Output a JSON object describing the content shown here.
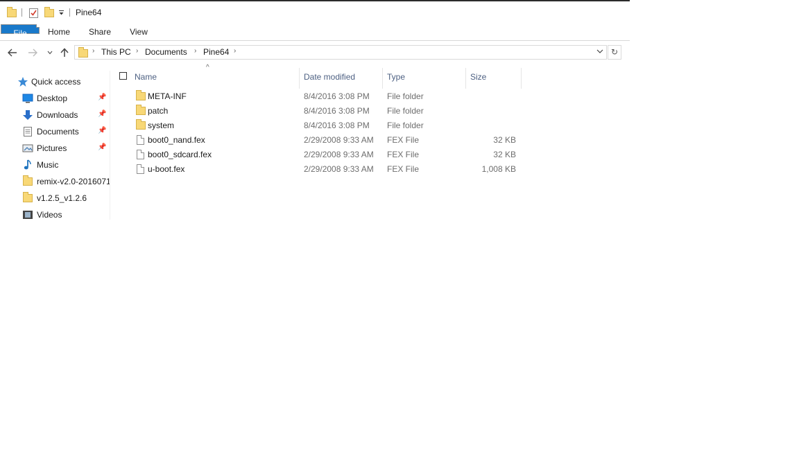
{
  "window": {
    "title": "Pine64"
  },
  "ribbon": {
    "tabs": [
      "File",
      "Home",
      "Share",
      "View"
    ]
  },
  "address": {
    "crumbs": [
      "This PC",
      "Documents",
      "Pine64"
    ]
  },
  "sidebar": {
    "items": [
      {
        "label": "Quick access",
        "icon": "star-icon",
        "pinned": false
      },
      {
        "label": "Desktop",
        "icon": "desktop-icon",
        "pinned": true
      },
      {
        "label": "Downloads",
        "icon": "download-icon",
        "pinned": true
      },
      {
        "label": "Documents",
        "icon": "documents-icon",
        "pinned": true
      },
      {
        "label": "Pictures",
        "icon": "pictures-icon",
        "pinned": true
      },
      {
        "label": "Music",
        "icon": "music-icon",
        "pinned": false
      },
      {
        "label": "remix-v2.0-2016071",
        "icon": "folder-icon",
        "pinned": false
      },
      {
        "label": "v1.2.5_v1.2.6",
        "icon": "folder-icon",
        "pinned": false
      },
      {
        "label": "Videos",
        "icon": "videos-icon",
        "pinned": false
      }
    ]
  },
  "columns": {
    "name": "Name",
    "date": "Date modified",
    "type": "Type",
    "size": "Size"
  },
  "files": [
    {
      "name": "META-INF",
      "date": "8/4/2016 3:08 PM",
      "type": "File folder",
      "size": "",
      "kind": "folder"
    },
    {
      "name": "patch",
      "date": "8/4/2016 3:08 PM",
      "type": "File folder",
      "size": "",
      "kind": "folder"
    },
    {
      "name": "system",
      "date": "8/4/2016 3:08 PM",
      "type": "File folder",
      "size": "",
      "kind": "folder"
    },
    {
      "name": "boot0_nand.fex",
      "date": "2/29/2008 9:33 AM",
      "type": "FEX File",
      "size": "32 KB",
      "kind": "file"
    },
    {
      "name": "boot0_sdcard.fex",
      "date": "2/29/2008 9:33 AM",
      "type": "FEX File",
      "size": "32 KB",
      "kind": "file"
    },
    {
      "name": "u-boot.fex",
      "date": "2/29/2008 9:33 AM",
      "type": "FEX File",
      "size": "1,008 KB",
      "kind": "file"
    }
  ],
  "colors": {
    "file_tab": "#1979ca",
    "folder": "#f8d877",
    "header_text": "#4d6082"
  }
}
